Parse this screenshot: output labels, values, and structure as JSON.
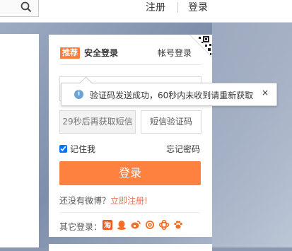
{
  "header": {
    "register_label": "注册",
    "login_label": "登录"
  },
  "login_card": {
    "recommend_badge": "推荐",
    "tab_safe_login": "安全登录",
    "tab_account_login": "帐号登录",
    "sms_resend_label": "29秒后再获取短信",
    "sms_code_placeholder": "短信验证码",
    "remember_me_label": "记住我",
    "remember_me_checked": true,
    "forgot_password_label": "忘记密码",
    "login_button_label": "登录",
    "no_account_text": "还没有微博？",
    "register_now_label": "立即注册!",
    "other_login_label": "其它登录："
  },
  "tooltip": {
    "message": "验证码发送成功，60秒内未收到请重新获取",
    "close_glyph": "×"
  },
  "colors": {
    "accent": "#ff8140",
    "badge": "#fa7d3c",
    "link": "#eb7350",
    "info_icon": "#6aa3d8"
  },
  "icons": [
    "search-icon",
    "qr-code-icon",
    "info-icon",
    "close-icon",
    "taobao-icon",
    "qq-icon",
    "weibo-icon",
    "360-icon",
    "tianyi-icon",
    "paw-icon"
  ]
}
